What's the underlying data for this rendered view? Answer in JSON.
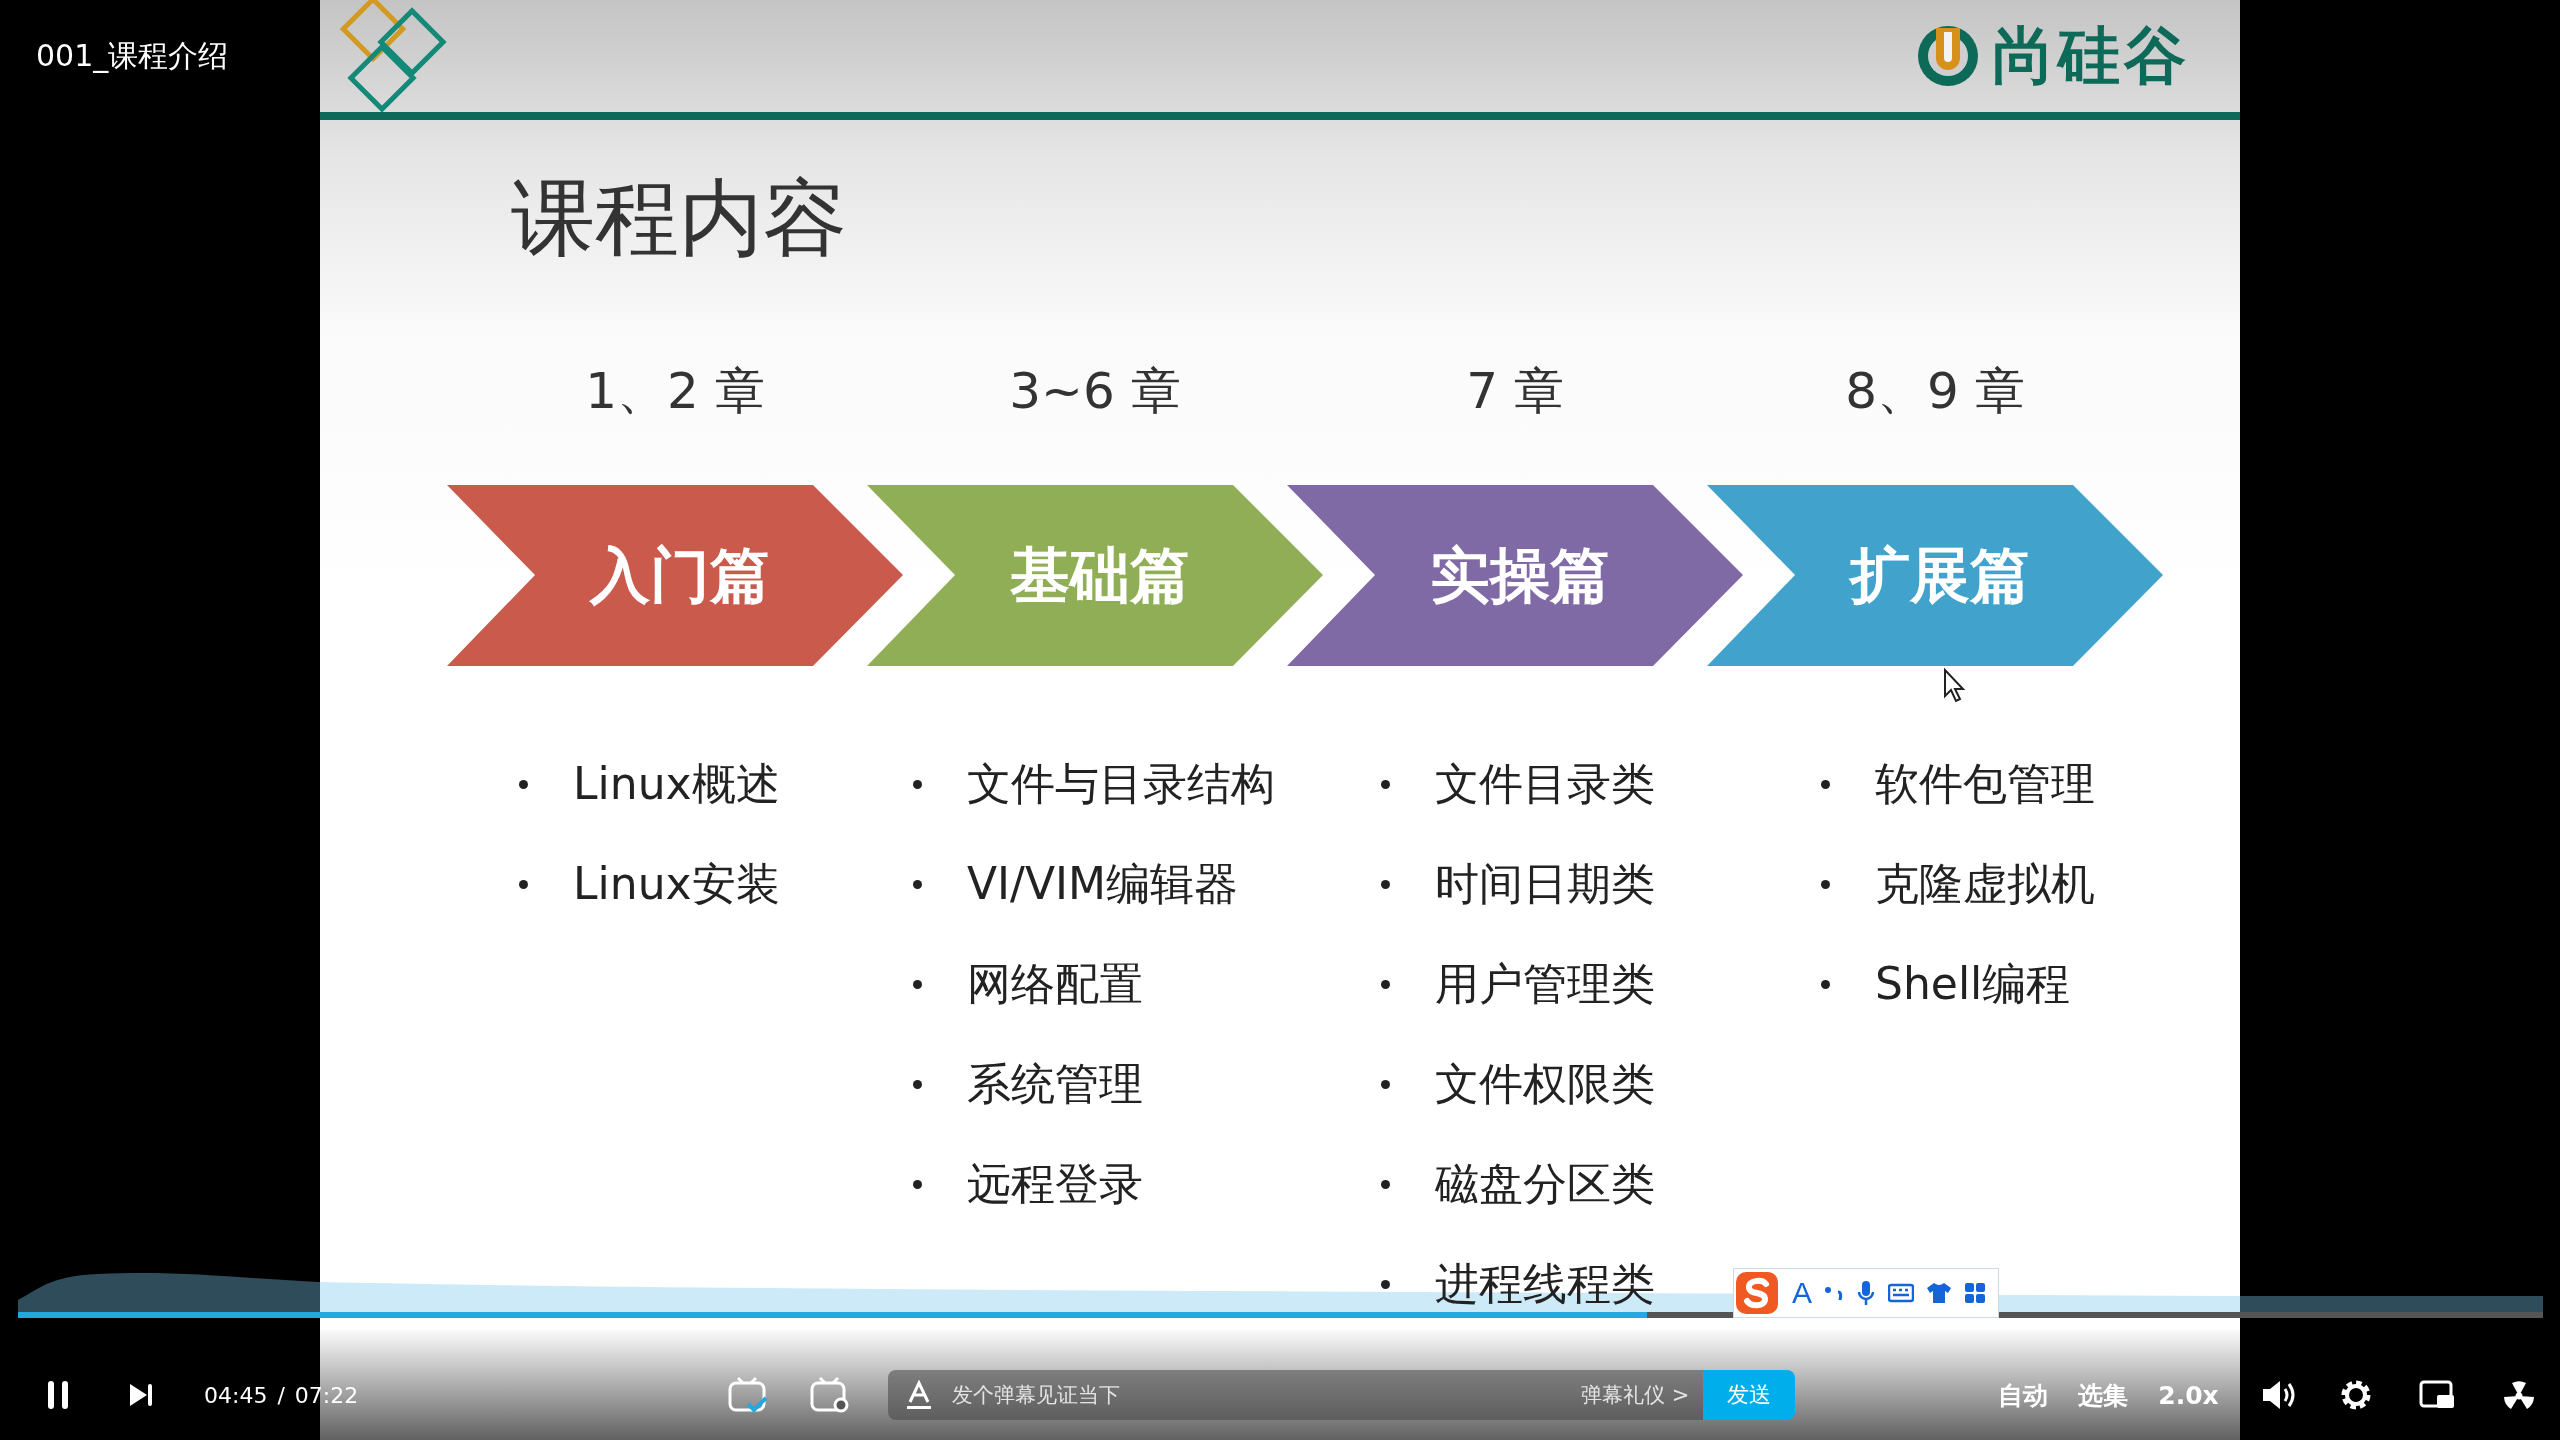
{
  "video": {
    "title": "001_课程介绍",
    "elapsed": "04:45",
    "separator": "/",
    "duration": "07:22",
    "progress": {
      "level": 0.645
    }
  },
  "slide": {
    "logo_text": "尚硅谷",
    "title": "课程内容",
    "columns": [
      {
        "chapters": "1、2 章",
        "label": "入门篇",
        "color": "#c95a4c",
        "topics": [
          "Linux概述",
          "Linux安装"
        ]
      },
      {
        "chapters": "3~6 章",
        "label": "基础篇",
        "color": "#8fae55",
        "topics": [
          "文件与目录结构",
          "VI/VIM编辑器",
          "网络配置",
          "系统管理",
          "远程登录"
        ]
      },
      {
        "chapters": "7 章",
        "label": "实操篇",
        "color": "#7f6aa5",
        "topics": [
          "文件目录类",
          "时间日期类",
          "用户管理类",
          "文件权限类",
          "磁盘分区类",
          "进程线程类"
        ]
      },
      {
        "chapters": "8、9 章",
        "label": "扩展篇",
        "color": "#41a3cc",
        "topics": [
          "软件包管理",
          "克隆虚拟机",
          "Shell编程"
        ]
      }
    ]
  },
  "ime_toolbar": {
    "letter": "A"
  },
  "danmaku": {
    "placeholder": "发个弹幕见证当下",
    "etiquette": "弹幕礼仪 >",
    "send": "发送"
  },
  "controls": {
    "auto": "自动",
    "episodes": "选集",
    "speed": "2.0x"
  }
}
